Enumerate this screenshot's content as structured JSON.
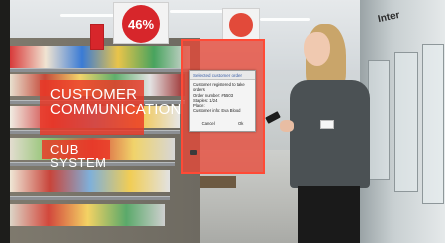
{
  "scene": {
    "signs": {
      "sale_price": "46%",
      "customer_communication": "CUSTOMER\nCOMMUNICATION",
      "cub_system": "CUB SYSTEM"
    },
    "store_sign_right": "Inter"
  },
  "handheld_dialog": {
    "title": "Selected customer order",
    "lines": [
      "Customer registered to take",
      "orders",
      "Order number: #5503",
      "Staples: 1/24",
      "Place:",
      "Customer info: Eva Blood"
    ],
    "cancel_label": "Cancel",
    "ok_label": "Ok"
  },
  "colors": {
    "overlay_red": "#ea3726",
    "dialog_title": "#3a5fa8"
  }
}
